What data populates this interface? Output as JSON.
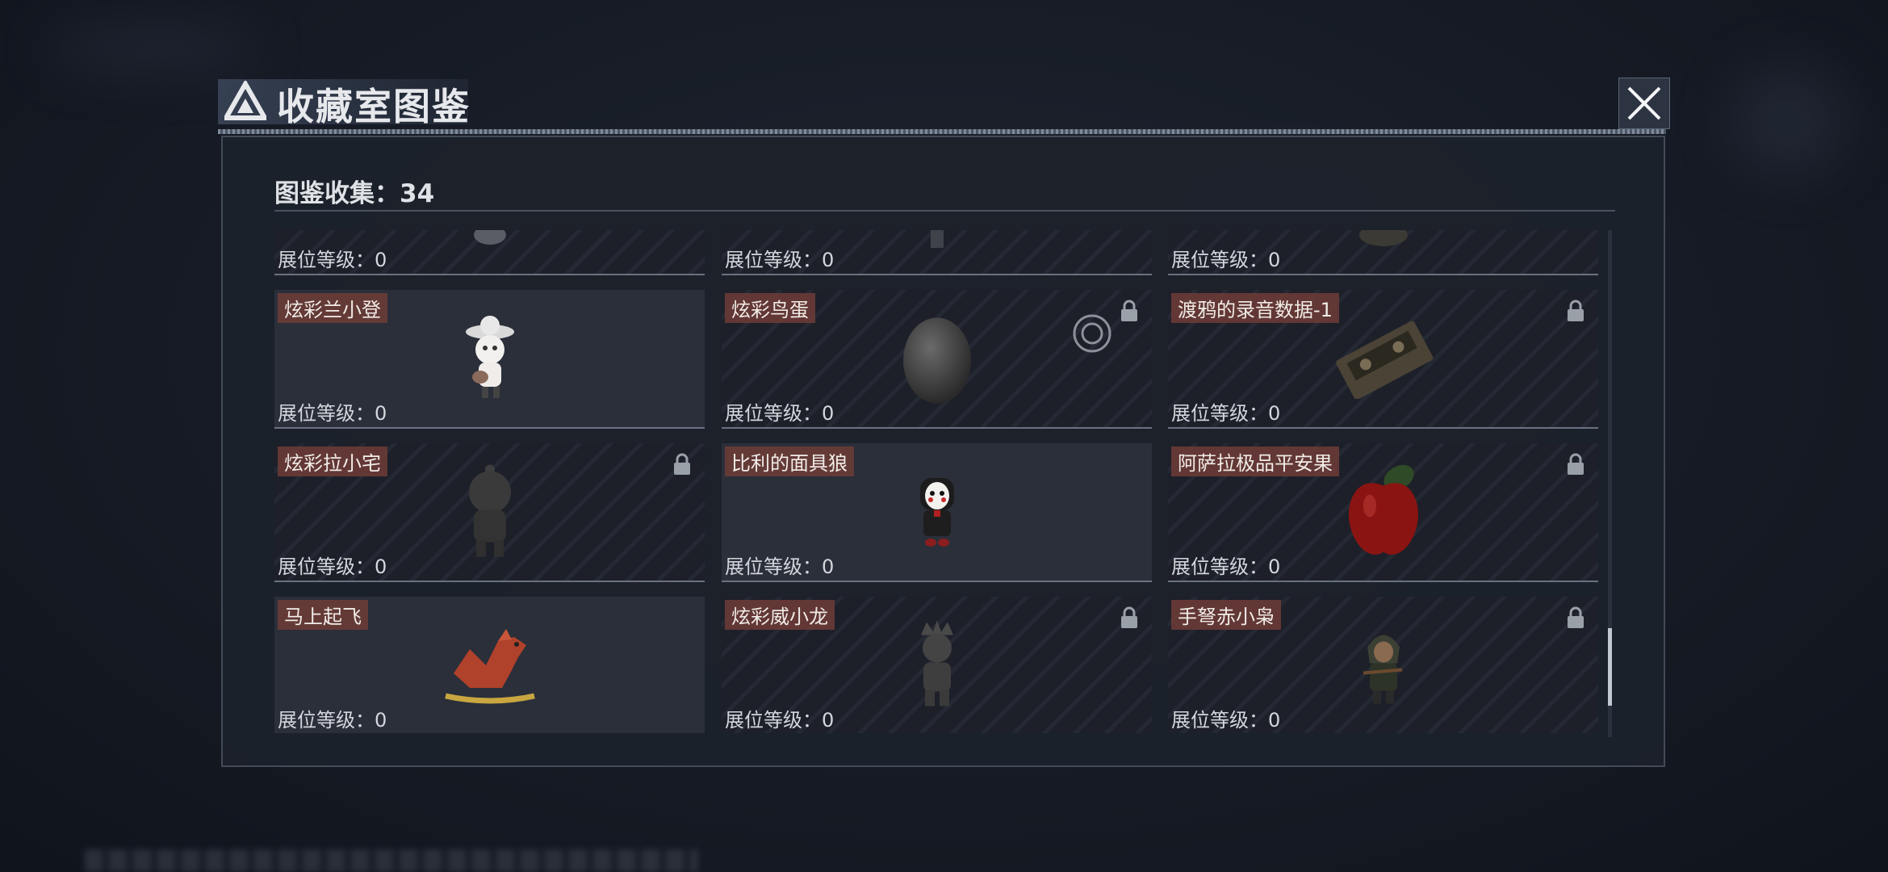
{
  "header": {
    "title": "收藏室图鉴"
  },
  "summary": {
    "label": "图鉴收集：34"
  },
  "cards": [
    {
      "name": "",
      "level": "展位等级：0",
      "locked": false,
      "icon": "figure-stub"
    },
    {
      "name": "",
      "level": "展位等级：0",
      "locked": false,
      "icon": "figure-stub"
    },
    {
      "name": "",
      "level": "展位等级：0",
      "locked": false,
      "icon": "figure-stub"
    },
    {
      "name": "炫彩兰小登",
      "level": "展位等级：0",
      "locked": false,
      "icon": "sombrero-guitar-figure"
    },
    {
      "name": "炫彩鸟蛋",
      "level": "展位等级：0",
      "locked": true,
      "icon": "egg"
    },
    {
      "name": "渡鸦的录音数据-1",
      "level": "展位等级：0",
      "locked": true,
      "icon": "cassette-tape"
    },
    {
      "name": "炫彩拉小宅",
      "level": "展位等级：0",
      "locked": true,
      "icon": "hooded-figure"
    },
    {
      "name": "比利的面具狼",
      "level": "展位等级：0",
      "locked": false,
      "icon": "puppet-mask-figure"
    },
    {
      "name": "阿萨拉极品平安果",
      "level": "展位等级：0",
      "locked": true,
      "icon": "apple"
    },
    {
      "name": "马上起飞",
      "level": "展位等级：0",
      "locked": false,
      "icon": "rocking-horse"
    },
    {
      "name": "炫彩威小龙",
      "level": "展位等级：0",
      "locked": true,
      "icon": "crown-figure"
    },
    {
      "name": "手弩赤小枭",
      "level": "展位等级：0",
      "locked": true,
      "icon": "hooded-crossbow-figure"
    }
  ],
  "colors": {
    "name_tag": "#6e3c37",
    "background": "#161b25",
    "panel": "#1c212b"
  }
}
